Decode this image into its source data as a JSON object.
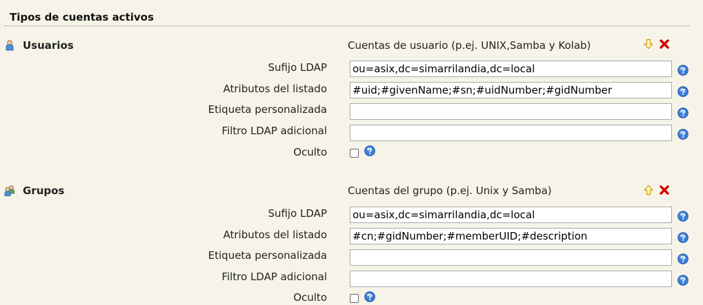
{
  "section": {
    "title": "Tipos de cuentas activos"
  },
  "types": [
    {
      "name": "Usuarios",
      "description": "Cuentas de usuario (p.ej. UNIX,Samba y Kolab)",
      "move_icon": "arrow-down-icon",
      "fields": {
        "suffix": {
          "label": "Sufijo LDAP",
          "value": "ou=asix,dc=simarrilandia,dc=local"
        },
        "attributes": {
          "label": "Atributos del listado",
          "value": "#uid;#givenName;#sn;#uidNumber;#gidNumber"
        },
        "custom_label": {
          "label": "Etiqueta personalizada",
          "value": ""
        },
        "filter": {
          "label": "Filtro LDAP adicional",
          "value": ""
        },
        "hidden": {
          "label": "Oculto",
          "checked": false
        }
      }
    },
    {
      "name": "Grupos",
      "description": "Cuentas del grupo (p.ej. Unix y Samba)",
      "move_icon": "arrow-up-icon",
      "fields": {
        "suffix": {
          "label": "Sufijo LDAP",
          "value": "ou=asix,dc=simarrilandia,dc=local"
        },
        "attributes": {
          "label": "Atributos del listado",
          "value": "#cn;#gidNumber;#memberUID;#description"
        },
        "custom_label": {
          "label": "Etiqueta personalizada",
          "value": ""
        },
        "filter": {
          "label": "Filtro LDAP adicional",
          "value": ""
        },
        "hidden": {
          "label": "Oculto",
          "checked": false
        }
      }
    }
  ],
  "colors": {
    "background": "#f6f4e8",
    "help": "#2f6fd0",
    "remove": "#d40000",
    "arrow": "#e6a800"
  }
}
